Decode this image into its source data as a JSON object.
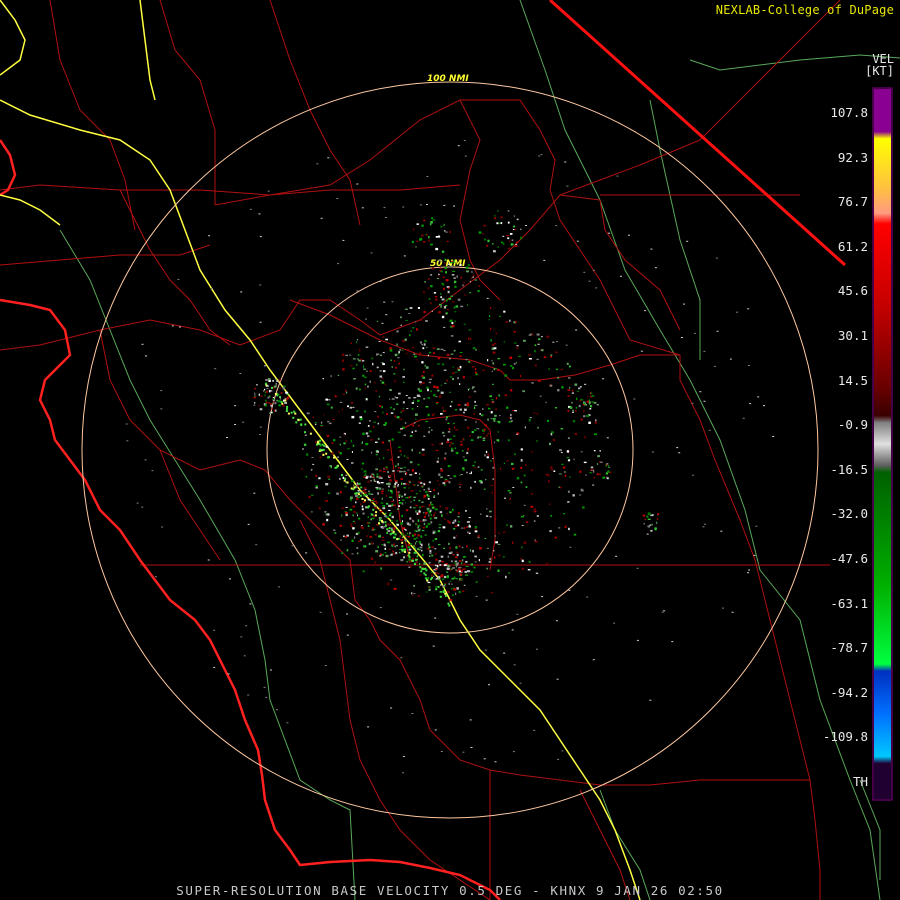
{
  "credit": "NEXLAB-College of DuPage",
  "caption": "SUPER-RESOLUTION BASE VELOCITY 0.5 DEG - KHNX 9 JAN 26 02:50",
  "ring_labels": [
    "100 NMI",
    "50 NMI"
  ],
  "legend": {
    "product": "VEL",
    "unit": "[KT]",
    "ticks": [
      "107.8",
      "92.3",
      "76.7",
      "61.2",
      "45.6",
      "30.1",
      "14.5",
      "-0.9",
      "-16.5",
      "-32.0",
      "-47.6",
      "-63.1",
      "-78.7",
      "-94.2",
      "-109.8",
      "TH"
    ],
    "colors": {
      "purple": "#8a0090",
      "yellow": "#ffff00",
      "salmon": "#ff9a80",
      "red": "#ff0000",
      "dark_red": "#5a0000",
      "gray": "#b0b0b0",
      "green": "#00e000",
      "blue": "#0050ff",
      "cyan": "#00c8ff",
      "th": "#200030"
    }
  },
  "map_colors": {
    "county_lines": "#b01010",
    "coastline": "#ff2020",
    "highways": "#ffff40",
    "state_line": "#ff1010",
    "range_rings": "#ffc8a0",
    "green_lines": "#60b060"
  }
}
